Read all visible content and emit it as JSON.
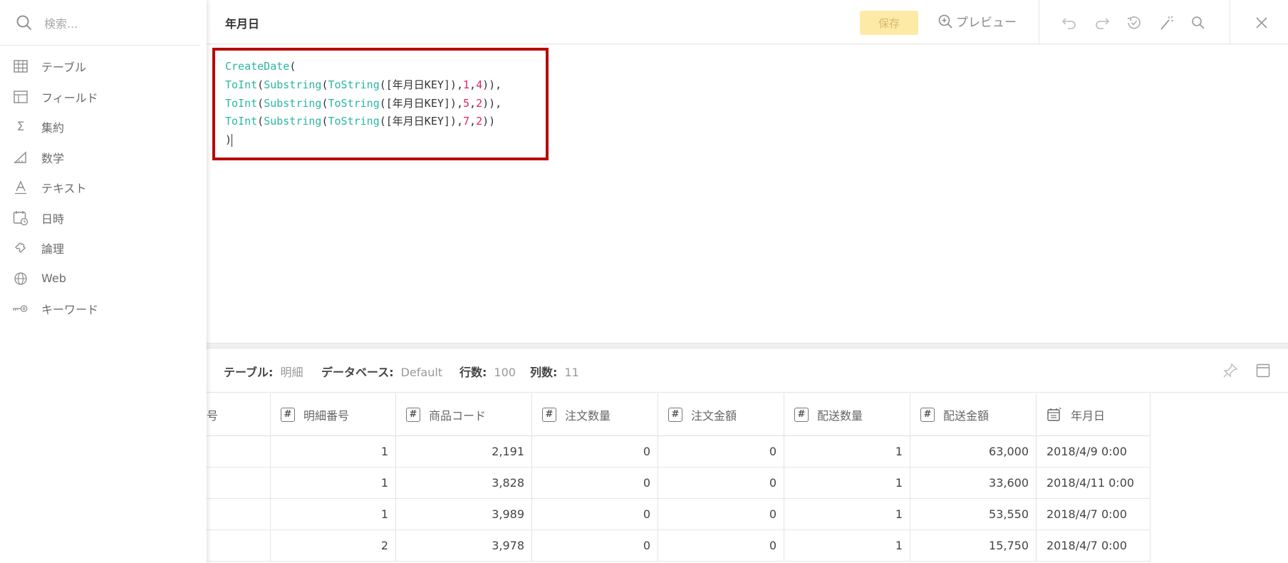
{
  "sidebar": {
    "search_placeholder": "検索...",
    "categories": [
      {
        "label": "テーブル",
        "icon": "table-icon"
      },
      {
        "label": "フィールド",
        "icon": "field-icon"
      },
      {
        "label": "集約",
        "icon": "sigma-icon"
      },
      {
        "label": "数学",
        "icon": "math-icon"
      },
      {
        "label": "テキスト",
        "icon": "text-icon"
      },
      {
        "label": "日時",
        "icon": "calendar-clock-icon"
      },
      {
        "label": "論理",
        "icon": "puzzle-icon"
      },
      {
        "label": "Web",
        "icon": "globe-icon"
      },
      {
        "label": "キーワード",
        "icon": "key-icon"
      }
    ]
  },
  "header": {
    "field_title": "年月日",
    "save_label": "保存",
    "preview_label": "プレビュー"
  },
  "editor": {
    "lines": [
      "CreateDate(",
      "ToInt(Substring(ToString([年月日KEY]),1,4)),",
      "ToInt(Substring(ToString([年月日KEY]),5,2)),",
      "ToInt(Substring(ToString([年月日KEY]),7,2))",
      ")"
    ]
  },
  "info": {
    "table_key": "テーブル:",
    "table_val": "明細",
    "db_key": "データベース:",
    "db_val": "Default",
    "rows_key": "行数:",
    "rows_val": "100",
    "cols_key": "列数:",
    "cols_val": "11"
  },
  "table": {
    "partial_header": "号",
    "columns": [
      "明細番号",
      "商品コード",
      "注文数量",
      "注文金額",
      "配送数量",
      "配送金額",
      "年月日"
    ],
    "rows": [
      [
        "1",
        "2,191",
        "0",
        "0",
        "1",
        "63,000",
        "2018/4/9 0:00"
      ],
      [
        "1",
        "3,828",
        "0",
        "0",
        "1",
        "33,600",
        "2018/4/11 0:00"
      ],
      [
        "1",
        "3,989",
        "0",
        "0",
        "1",
        "53,550",
        "2018/4/7 0:00"
      ],
      [
        "2",
        "3,978",
        "0",
        "0",
        "1",
        "15,750",
        "2018/4/7 0:00"
      ]
    ]
  },
  "colors": {
    "accent_function": "#2bb7a2",
    "accent_number": "#e0236b",
    "save_bg": "#fdeaa6",
    "highlight_border": "#b8090b"
  }
}
